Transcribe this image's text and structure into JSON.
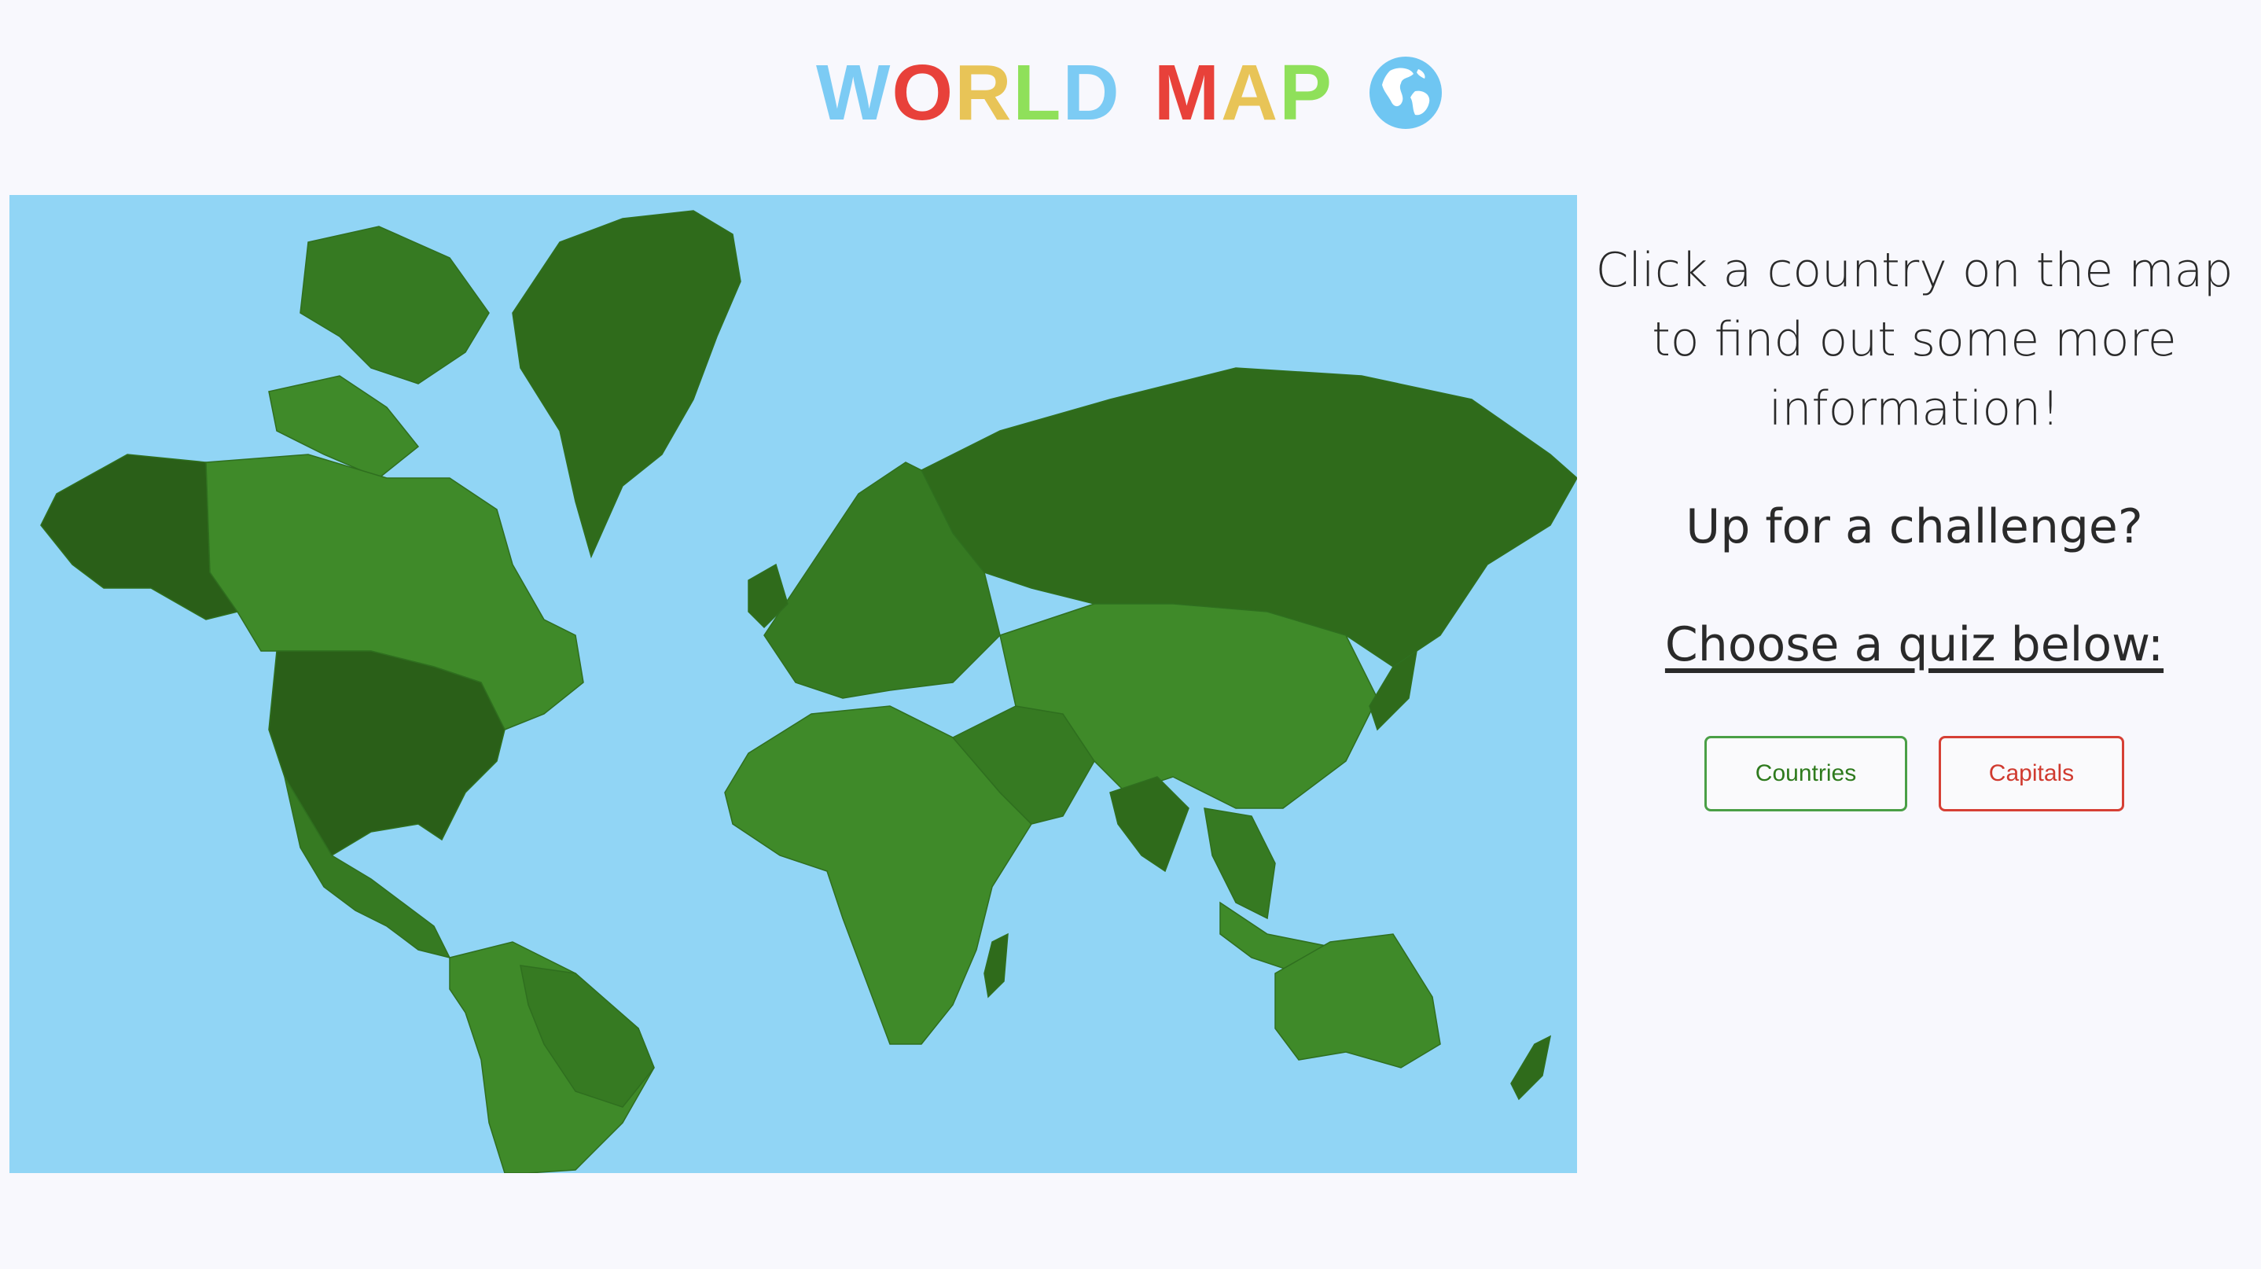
{
  "title": {
    "words": [
      [
        {
          "ch": "W",
          "color": "#7ccbf4"
        },
        {
          "ch": "O",
          "color": "#e8413a"
        },
        {
          "ch": "R",
          "color": "#e8c457"
        },
        {
          "ch": "L",
          "color": "#8fe05a"
        },
        {
          "ch": "D",
          "color": "#7ccbf4"
        }
      ],
      [
        {
          "ch": "M",
          "color": "#e8413a"
        },
        {
          "ch": "A",
          "color": "#e8c457"
        },
        {
          "ch": "P",
          "color": "#8fe05a"
        }
      ]
    ],
    "icon": "globe-icon"
  },
  "sidebar": {
    "intro": "Click a country on the map to find out some more information!",
    "challenge": "Up for a challenge?",
    "choose": "Choose a quiz below:"
  },
  "quiz_buttons": {
    "countries": "Countries",
    "capitals": "Capitals"
  },
  "colors": {
    "ocean": "#91d5f5",
    "land_shades": [
      "#2f6b1b",
      "#367a22",
      "#3f8a29",
      "#2a5f18"
    ]
  }
}
